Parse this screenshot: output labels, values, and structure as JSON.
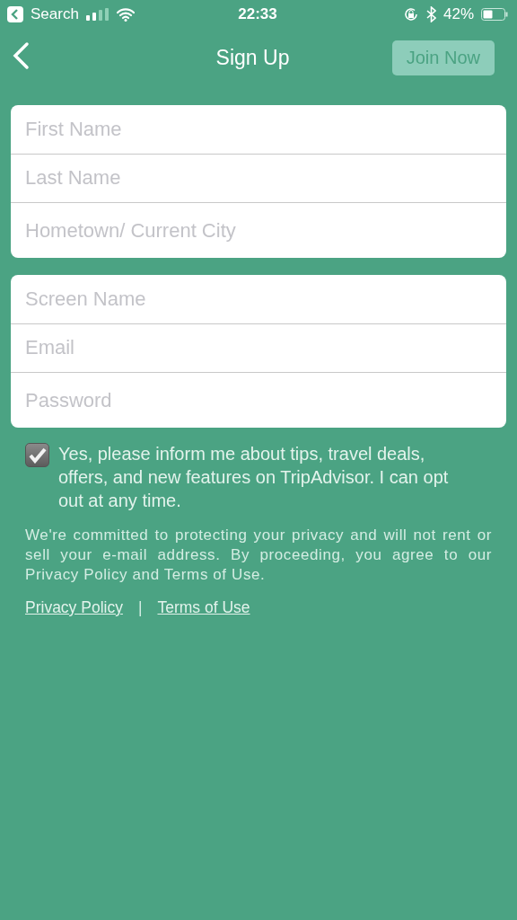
{
  "status_bar": {
    "back_label": "Search",
    "time": "22:33",
    "battery_text": "42%"
  },
  "nav": {
    "title": "Sign Up",
    "action": {
      "label": "Join Now",
      "disabled": true
    }
  },
  "field_groups": [
    {
      "fields": [
        {
          "placeholder": "First Name"
        },
        {
          "placeholder": "Last Name"
        },
        {
          "placeholder": "Hometown/ Current City"
        }
      ]
    },
    {
      "fields": [
        {
          "placeholder": "Screen Name"
        },
        {
          "placeholder": "Email"
        },
        {
          "placeholder": "Password"
        }
      ]
    }
  ],
  "opt_in": {
    "checked": true,
    "label": "Yes, please inform me about tips, travel deals, offers, and new features on TripAdvisor. I can opt out at any time."
  },
  "privacy_note": "We're committed to protecting your privacy and will not rent or sell your e-mail address. By proceeding, you agree to our Privacy Policy and Terms of Use.",
  "links": [
    "Privacy Policy",
    "Terms of Use"
  ],
  "link_separator": "|"
}
